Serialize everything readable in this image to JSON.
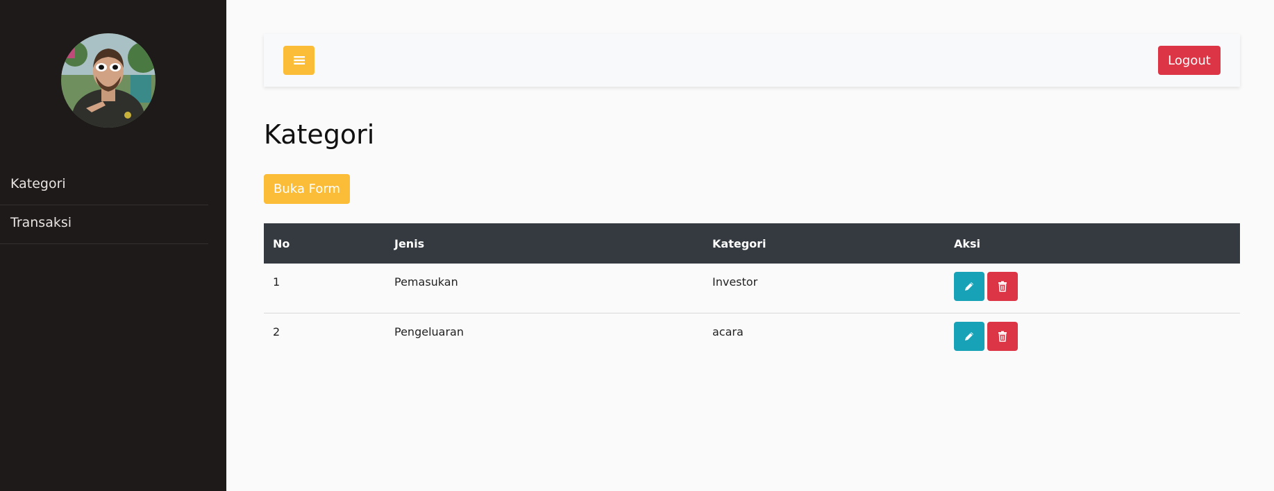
{
  "sidebar": {
    "avatar": "avatar",
    "items": [
      {
        "label": "Kategori"
      },
      {
        "label": "Transaksi"
      }
    ]
  },
  "topbar": {
    "menu_icon": "hamburger-icon",
    "logout_label": "Logout"
  },
  "page": {
    "title": "Kategori",
    "open_form_label": "Buka Form"
  },
  "table": {
    "headers": [
      "No",
      "Jenis",
      "Kategori",
      "Aksi"
    ],
    "rows": [
      {
        "no": "1",
        "jenis": "Pemasukan",
        "kategori": "Investor"
      },
      {
        "no": "2",
        "jenis": "Pengeluaran",
        "kategori": "acara"
      }
    ]
  },
  "colors": {
    "sidebar_bg": "#1e1a19",
    "accent_yellow": "#fbbd38",
    "danger": "#dc3545",
    "info": "#17a2b8",
    "table_header": "#343a40"
  }
}
